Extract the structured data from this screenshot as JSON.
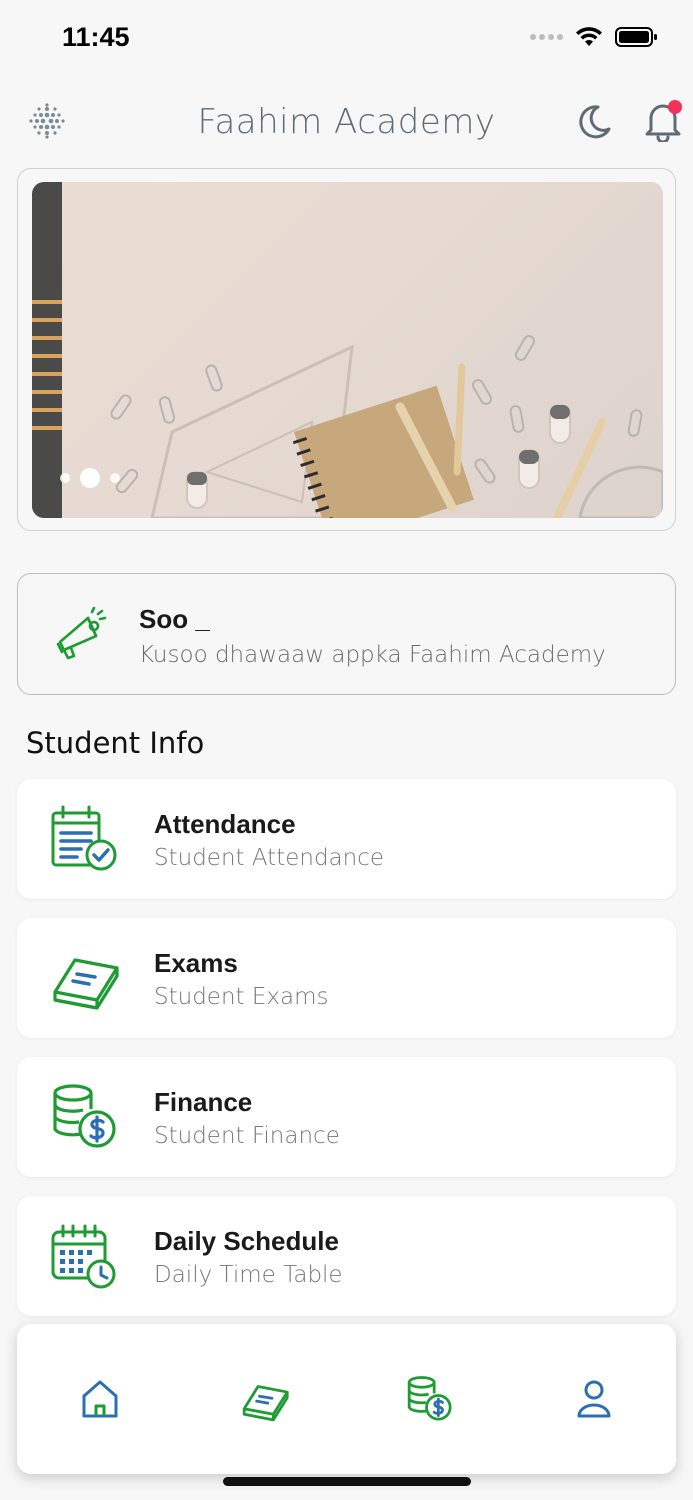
{
  "status": {
    "time": "11:45"
  },
  "header": {
    "title": "Faahim Academy"
  },
  "banner": {
    "slide_count": 3,
    "active_slide": 2
  },
  "notice": {
    "title": "Soo _",
    "subtitle": "Kusoo dhawaaw appka Faahim Academy"
  },
  "section": {
    "title": "Student Info"
  },
  "items": [
    {
      "title": "Attendance",
      "subtitle": "Student  Attendance",
      "icon": "attendance-icon"
    },
    {
      "title": "Exams",
      "subtitle": "Student  Exams",
      "icon": "book-icon"
    },
    {
      "title": "Finance",
      "subtitle": "Student  Finance",
      "icon": "coins-dollar-icon"
    },
    {
      "title": "Daily Schedule",
      "subtitle": "Daily Time Table",
      "icon": "calendar-clock-icon"
    }
  ],
  "nav": [
    {
      "icon": "home-icon"
    },
    {
      "icon": "book-icon"
    },
    {
      "icon": "coins-dollar-icon"
    },
    {
      "icon": "user-icon"
    }
  ],
  "colors": {
    "accent_green": "#1e9b32",
    "accent_blue": "#2b6fb3",
    "notification_dot": "#f2305a",
    "title_gray": "#5f6b74"
  }
}
